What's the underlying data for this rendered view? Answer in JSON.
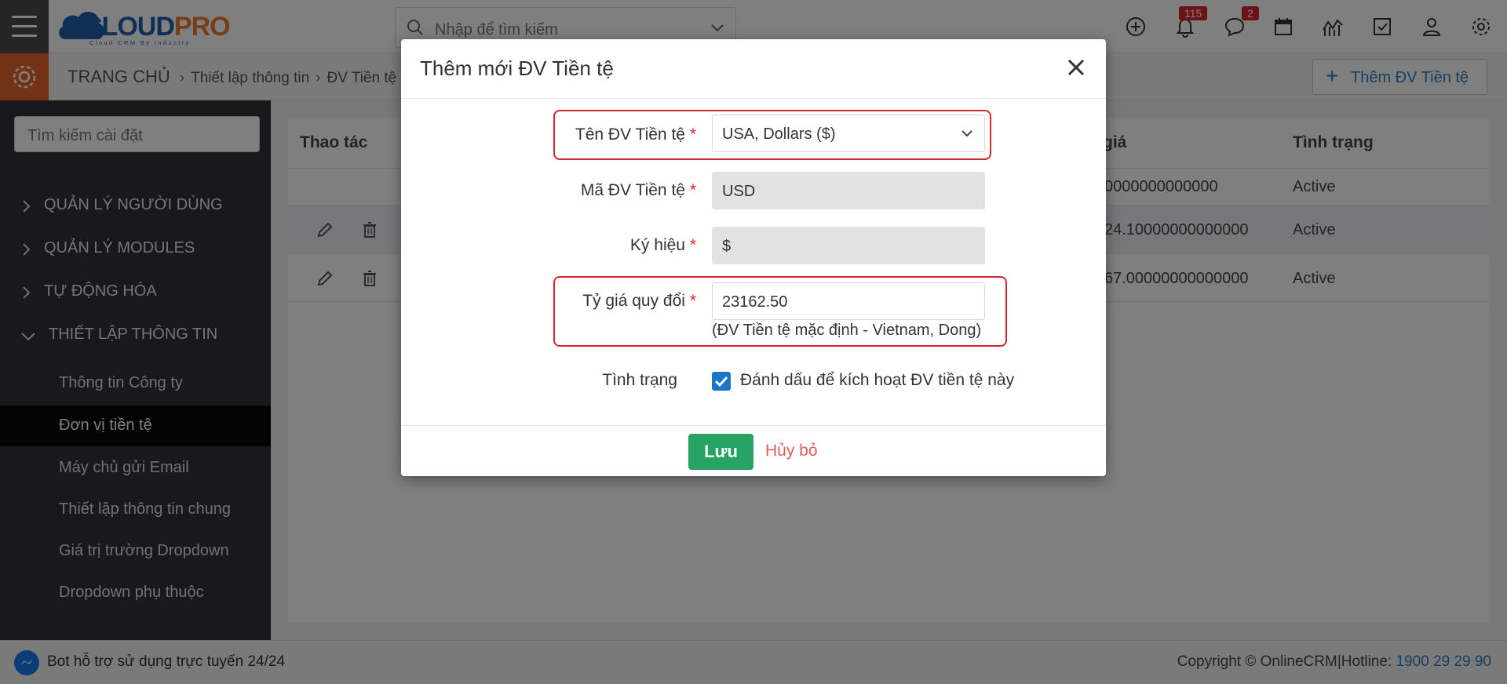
{
  "header": {
    "logo_main_cloud": "CLOUD",
    "logo_main_pro": "PRO",
    "logo_sub": "Cloud CRM By Industry",
    "search_placeholder": "Nhập để tìm kiếm",
    "notification_count": "115",
    "message_count": "2",
    "icons": [
      "plus-circle-icon",
      "bell-icon",
      "chat-icon",
      "calendar-icon",
      "chart-icon",
      "checkbox-icon",
      "user-icon",
      "gear-icon"
    ]
  },
  "breadcrumb": {
    "home": "TRANG CHỦ",
    "level1": "Thiết lập thông tin",
    "level2": "ĐV Tiền tệ"
  },
  "add_button_label": "Thêm ĐV Tiền tệ",
  "sidebar": {
    "search_placeholder": "Tìm kiếm cài đặt",
    "sections": [
      {
        "label": "QUẢN LÝ NGƯỜI DÙNG",
        "expanded": false
      },
      {
        "label": "QUẢN LÝ MODULES",
        "expanded": false
      },
      {
        "label": "TỰ ĐỘNG HÓA",
        "expanded": false
      },
      {
        "label": "THIẾT LẬP THÔNG TIN",
        "expanded": true
      }
    ],
    "sub_items": [
      {
        "label": "Thông tin Công ty",
        "active": false
      },
      {
        "label": "Đơn vị tiền tệ",
        "active": true
      },
      {
        "label": "Máy chủ gửi Email",
        "active": false
      },
      {
        "label": "Thiết lập thông tin chung",
        "active": false
      },
      {
        "label": "Giá trị trường Dropdown",
        "active": false
      },
      {
        "label": "Dropdown phụ thuộc",
        "active": false
      }
    ]
  },
  "table": {
    "headers": {
      "actions": "Thao tác",
      "rate": "giá",
      "status": "Tình trạng"
    },
    "rows": [
      {
        "rate": "0000000000000",
        "status": "Active"
      },
      {
        "rate": "24.10000000000000",
        "status": "Active"
      },
      {
        "rate": "67.00000000000000",
        "status": "Active"
      }
    ]
  },
  "modal": {
    "title": "Thêm mới ĐV Tiền tệ",
    "fields": {
      "currency_name_label": "Tên ĐV Tiền tệ",
      "currency_name_value": "USA, Dollars ($)",
      "currency_code_label": "Mã ĐV Tiền tệ",
      "currency_code_value": "USD",
      "symbol_label": "Ký hiệu",
      "symbol_value": "$",
      "rate_label": "Tỷ giá quy đổi",
      "rate_value": "23162.50",
      "rate_hint": "(ĐV Tiền tệ mặc định - Vietnam, Dong)",
      "status_label": "Tình trạng",
      "status_checkbox_label": "Đánh dấu để kích hoạt ĐV tiền tệ này",
      "status_checked": true,
      "required_mark": "*"
    },
    "save_label": "Lưu",
    "cancel_label": "Hủy bỏ"
  },
  "footer": {
    "bot_text": "Bot hỗ trợ sử dụng trực tuyến 24/24",
    "copyright": "Copyright © OnlineCRM",
    "hotline_label": "|Hotline: ",
    "hotline_number": "1900 29 29 90"
  },
  "colors": {
    "accent_orange": "#e8652b",
    "sidebar_bg": "#2f3337",
    "primary_blue": "#2a80c5",
    "save_green": "#27a464",
    "highlight_red": "#d7262b",
    "badge_red": "#d9272e"
  }
}
